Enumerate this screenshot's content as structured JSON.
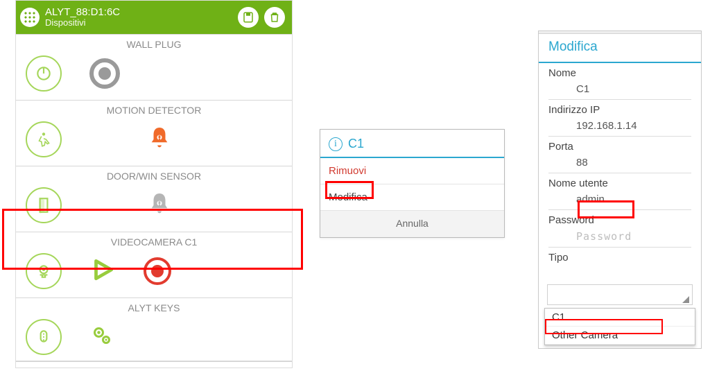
{
  "header": {
    "device_name": "ALYT_88:D1:6C",
    "subtitle": "Dispositivi"
  },
  "devices": {
    "wall_plug": "WALL PLUG",
    "motion": "MOTION DETECTOR",
    "door": "DOOR/WIN SENSOR",
    "camera": "VIDEOCAMERA C1",
    "keys": "ALYT KEYS"
  },
  "dialog": {
    "title": "C1",
    "remove": "Rimuovi",
    "modify": "Modifica",
    "cancel": "Annulla"
  },
  "edit": {
    "title": "Modifica",
    "name_label": "Nome",
    "name_value": "C1",
    "ip_label": "Indirizzo IP",
    "ip_value": "192.168.1.14",
    "port_label": "Porta",
    "port_value": "88",
    "user_label": "Nome utente",
    "user_value": "admin",
    "pass_label": "Password",
    "pass_placeholder": "Password",
    "type_label": "Tipo",
    "opt1": "C1",
    "opt2": "Other Camera"
  }
}
